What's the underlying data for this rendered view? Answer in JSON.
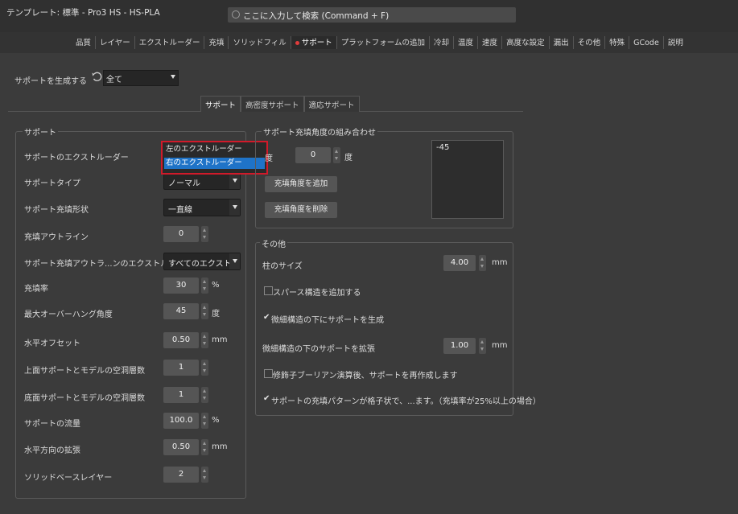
{
  "window": {
    "title": "テンプレート: 標準 - Pro3 HS - HS-PLA",
    "search_placeholder": "ここに入力して検索 (Command + F)"
  },
  "main_tabs": [
    {
      "label": "品質",
      "active": false
    },
    {
      "label": "レイヤー",
      "active": false
    },
    {
      "label": "エクストルーダー",
      "active": false
    },
    {
      "label": "充填",
      "active": false
    },
    {
      "label": "ソリッドフィル",
      "active": false
    },
    {
      "label": "サポート",
      "active": true
    },
    {
      "label": "プラットフォームの追加",
      "active": false
    },
    {
      "label": "冷却",
      "active": false
    },
    {
      "label": "温度",
      "active": false
    },
    {
      "label": "速度",
      "active": false
    },
    {
      "label": "高度な設定",
      "active": false
    },
    {
      "label": "漏出",
      "active": false
    },
    {
      "label": "その他",
      "active": false
    },
    {
      "label": "特殊",
      "active": false
    },
    {
      "label": "GCode",
      "active": false
    },
    {
      "label": "説明",
      "active": false
    }
  ],
  "generate": {
    "label": "サポートを生成する",
    "value": "全て",
    "icon": "undo-icon"
  },
  "sub_tabs": [
    {
      "label": "サポート",
      "active": true
    },
    {
      "label": "高密度サポート",
      "active": false
    },
    {
      "label": "適応サポート",
      "active": false
    }
  ],
  "support_group": {
    "title": "サポート",
    "rows": [
      {
        "label": "サポートのエクストルーダー",
        "kind": "dropdown",
        "value": ""
      },
      {
        "label": "サポートタイプ",
        "kind": "dropdown",
        "value": "ノーマル"
      },
      {
        "label": "サポート充填形状",
        "kind": "dropdown",
        "value": "一直線"
      },
      {
        "label": "充填アウトライン",
        "kind": "spin",
        "value": "0",
        "unit": ""
      },
      {
        "label": "サポート充填アウトラ...ンのエクストルーダー",
        "kind": "dropdown",
        "value": "すべてのエクストルーダー"
      },
      {
        "label": "充填率",
        "kind": "spin",
        "value": "30",
        "unit": "%"
      },
      {
        "label": "最大オーバーハング角度",
        "kind": "spin",
        "value": "45",
        "unit": "度"
      },
      {
        "label": "水平オフセット",
        "kind": "spin",
        "value": "0.50",
        "unit": "mm"
      },
      {
        "label": "上面サポートとモデルの空洞層数",
        "kind": "spin",
        "value": "1",
        "unit": ""
      },
      {
        "label": "底面サポートとモデルの空洞層数",
        "kind": "spin",
        "value": "1",
        "unit": ""
      },
      {
        "label": "サポートの流量",
        "kind": "spin",
        "value": "100.0",
        "unit": "%"
      },
      {
        "label": "水平方向の拡張",
        "kind": "spin",
        "value": "0.50",
        "unit": "mm"
      },
      {
        "label": "ソリッドベースレイヤー",
        "kind": "spin",
        "value": "2",
        "unit": ""
      }
    ]
  },
  "extruder_popup": {
    "options": [
      "左のエクストルーダー",
      "右のエクストルーダー"
    ],
    "selected_index": 1,
    "highlight_color": "#d11a2a"
  },
  "angle_group": {
    "title": "サポート充填角度の組み合わせ",
    "angle_label": "度",
    "angle_value": "0",
    "angle_unit": "度",
    "add_button": "充填角度を追加",
    "remove_button": "充填角度を削除",
    "angles": [
      "-45"
    ]
  },
  "other_group": {
    "title": "その他",
    "pillar_size_label": "柱のサイズ",
    "pillar_size_value": "4.00",
    "pillar_size_unit": "mm",
    "sparse_label": "スパース構造を追加する",
    "sparse_checked": false,
    "fine_label": "微細構造の下にサポートを生成",
    "fine_checked": true,
    "extend_label": "微細構造の下のサポートを拡張",
    "extend_value": "1.00",
    "extend_unit": "mm",
    "boolean_label": "修飾子ブーリアン演算後、サポートを再作成します",
    "boolean_checked": false,
    "grid_label": "サポートの充填パターンが格子状で、...ます。（充填率が25%以上の場合）",
    "grid_checked": true
  },
  "colors": {
    "background": "#3b3b3b",
    "accent_blue": "#1f73c7",
    "active_dot": "#e03c3c"
  }
}
